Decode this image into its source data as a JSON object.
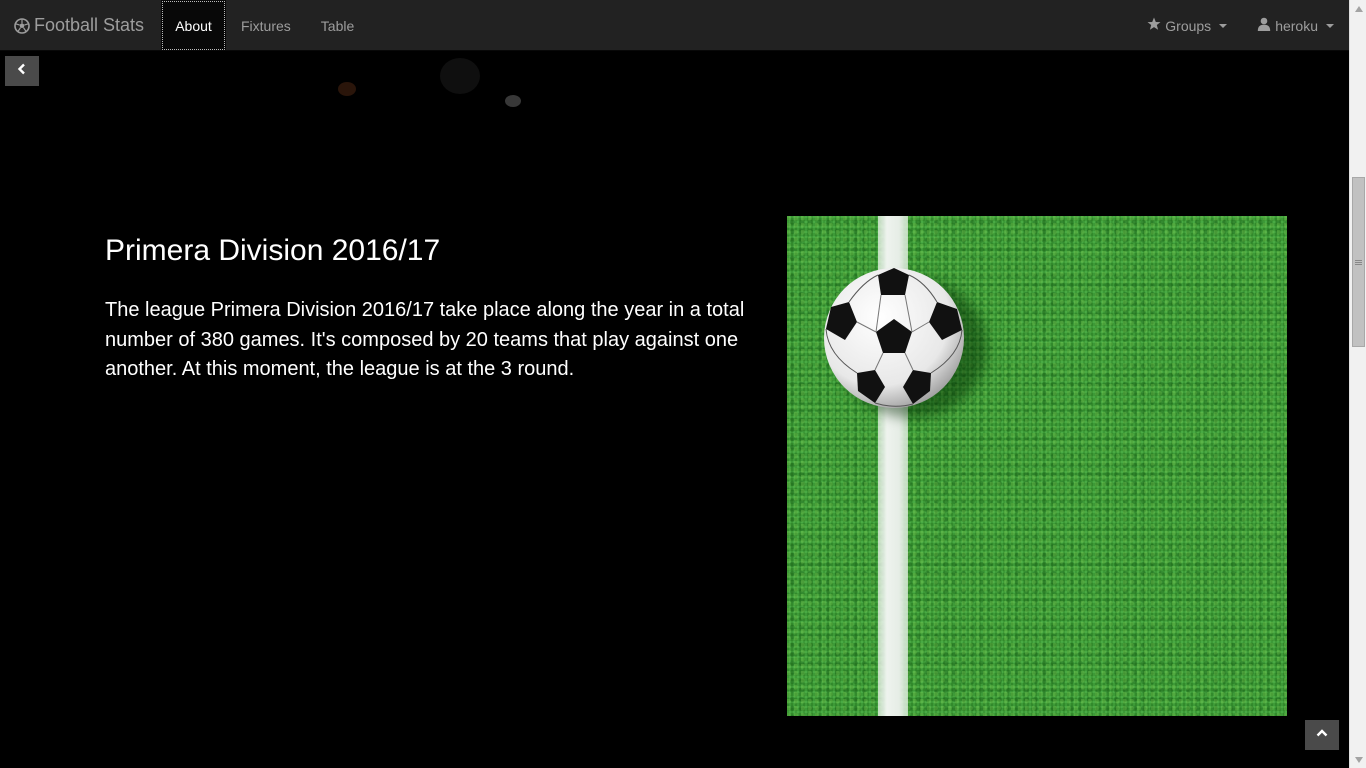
{
  "navbar": {
    "brand": "Football Stats",
    "links": [
      {
        "label": "About",
        "active": true
      },
      {
        "label": "Fixtures",
        "active": false
      },
      {
        "label": "Table",
        "active": false
      }
    ],
    "groups_label": "Groups",
    "user_label": "heroku"
  },
  "main": {
    "title": "Primera Division 2016/17",
    "description": "The league Primera Division 2016/17 take place along the year in a total number of 380 games. It's composed by 20 teams that play against one another. At this moment, the league is at the 3 round."
  },
  "icons": {
    "brand": "soccer-ball-icon",
    "groups": "star-icon",
    "user": "user-icon",
    "back": "chevron-left-icon",
    "top": "chevron-up-icon"
  },
  "colors": {
    "navbar_bg": "#222222",
    "nav_text": "#9d9d9d",
    "page_bg": "#000000",
    "grass": "#3aa334"
  }
}
